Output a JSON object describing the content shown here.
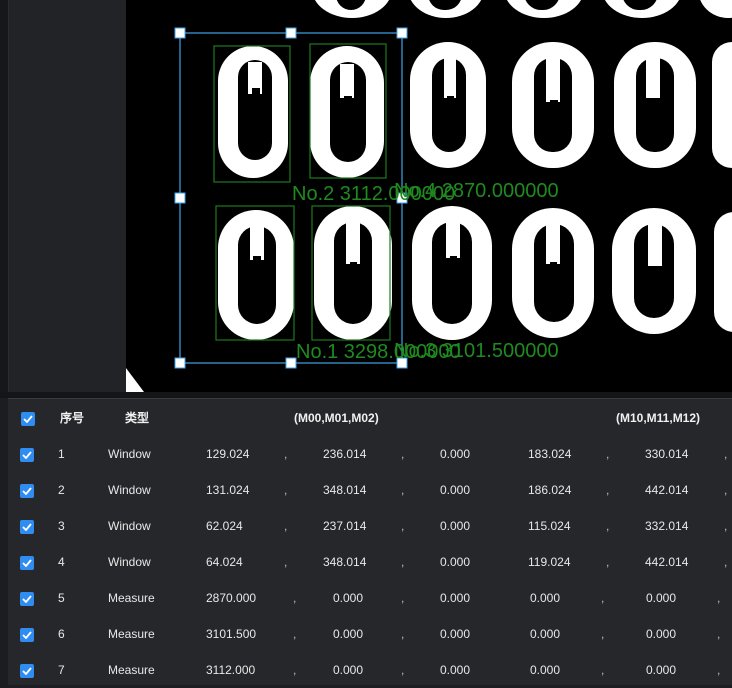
{
  "viewer": {
    "overlay_labels": [
      {
        "text": "No.2 3112.000000",
        "color": "#1f8a1f"
      },
      {
        "text": "No.4 2870.000000",
        "color": "#1f8a1f"
      },
      {
        "text": "No.1 3298.000000",
        "color": "#1f8a1f"
      },
      {
        "text": "No.3 3101.500000",
        "color": "#1f8a1f"
      }
    ],
    "selection_color": "#3ea3e8",
    "detection_box_color": "#1f7a1f"
  },
  "table": {
    "headers": {
      "index": "序号",
      "type": "类型",
      "m0": "(M00,M01,M02)",
      "m1": "(M10,M11,M12)"
    },
    "separator": ",",
    "rows": [
      {
        "index": "1",
        "type": "Window",
        "m00": "129.024",
        "m01": "236.014",
        "m02": "0.000",
        "m10": "183.024",
        "m11": "330.014"
      },
      {
        "index": "2",
        "type": "Window",
        "m00": "131.024",
        "m01": "348.014",
        "m02": "0.000",
        "m10": "186.024",
        "m11": "442.014"
      },
      {
        "index": "3",
        "type": "Window",
        "m00": "62.024",
        "m01": "237.014",
        "m02": "0.000",
        "m10": "115.024",
        "m11": "332.014"
      },
      {
        "index": "4",
        "type": "Window",
        "m00": "64.024",
        "m01": "348.014",
        "m02": "0.000",
        "m10": "119.024",
        "m11": "442.014"
      },
      {
        "index": "5",
        "type": "Measure",
        "m00": "2870.000",
        "m01": "0.000",
        "m02": "0.000",
        "m10": "0.000",
        "m11": "0.000"
      },
      {
        "index": "6",
        "type": "Measure",
        "m00": "3101.500",
        "m01": "0.000",
        "m02": "0.000",
        "m10": "0.000",
        "m11": "0.000"
      },
      {
        "index": "7",
        "type": "Measure",
        "m00": "3112.000",
        "m01": "0.000",
        "m02": "0.000",
        "m10": "0.000",
        "m11": "0.000"
      }
    ],
    "checkbox_color": "#2f8cf0"
  }
}
